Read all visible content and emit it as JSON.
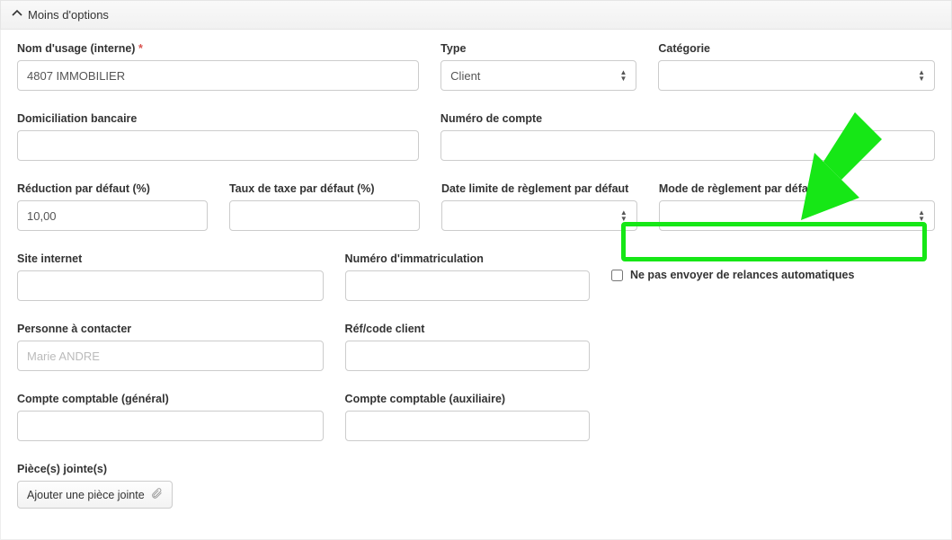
{
  "header": {
    "label": "Moins d'options"
  },
  "fields": {
    "nom_usage": {
      "label": "Nom d'usage (interne)",
      "required": "*",
      "value": "4807 IMMOBILIER"
    },
    "type": {
      "label": "Type",
      "value": "Client"
    },
    "categorie": {
      "label": "Catégorie",
      "value": ""
    },
    "domiciliation": {
      "label": "Domiciliation bancaire",
      "value": ""
    },
    "numero_compte": {
      "label": "Numéro de compte",
      "value": ""
    },
    "reduction": {
      "label": "Réduction par défaut (%)",
      "value": "10,00"
    },
    "taux_taxe": {
      "label": "Taux de taxe par défaut (%)",
      "value": ""
    },
    "date_limite": {
      "label": "Date limite de règlement par défaut",
      "value": ""
    },
    "mode_reglement": {
      "label": "Mode de règlement par défaut",
      "value": ""
    },
    "site_internet": {
      "label": "Site internet",
      "value": ""
    },
    "numero_immat": {
      "label": "Numéro d'immatriculation",
      "value": ""
    },
    "no_relances": {
      "label": "Ne pas envoyer de relances automatiques"
    },
    "personne_contact": {
      "label": "Personne à contacter",
      "placeholder": "Marie ANDRE",
      "value": ""
    },
    "ref_code": {
      "label": "Réf/code client",
      "value": ""
    },
    "compte_general": {
      "label": "Compte comptable (général)",
      "value": ""
    },
    "compte_aux": {
      "label": "Compte comptable (auxiliaire)",
      "value": ""
    },
    "pieces_jointes": {
      "label": "Pièce(s) jointe(s)"
    },
    "attach_btn": {
      "label": "Ajouter une pièce jointe"
    }
  }
}
